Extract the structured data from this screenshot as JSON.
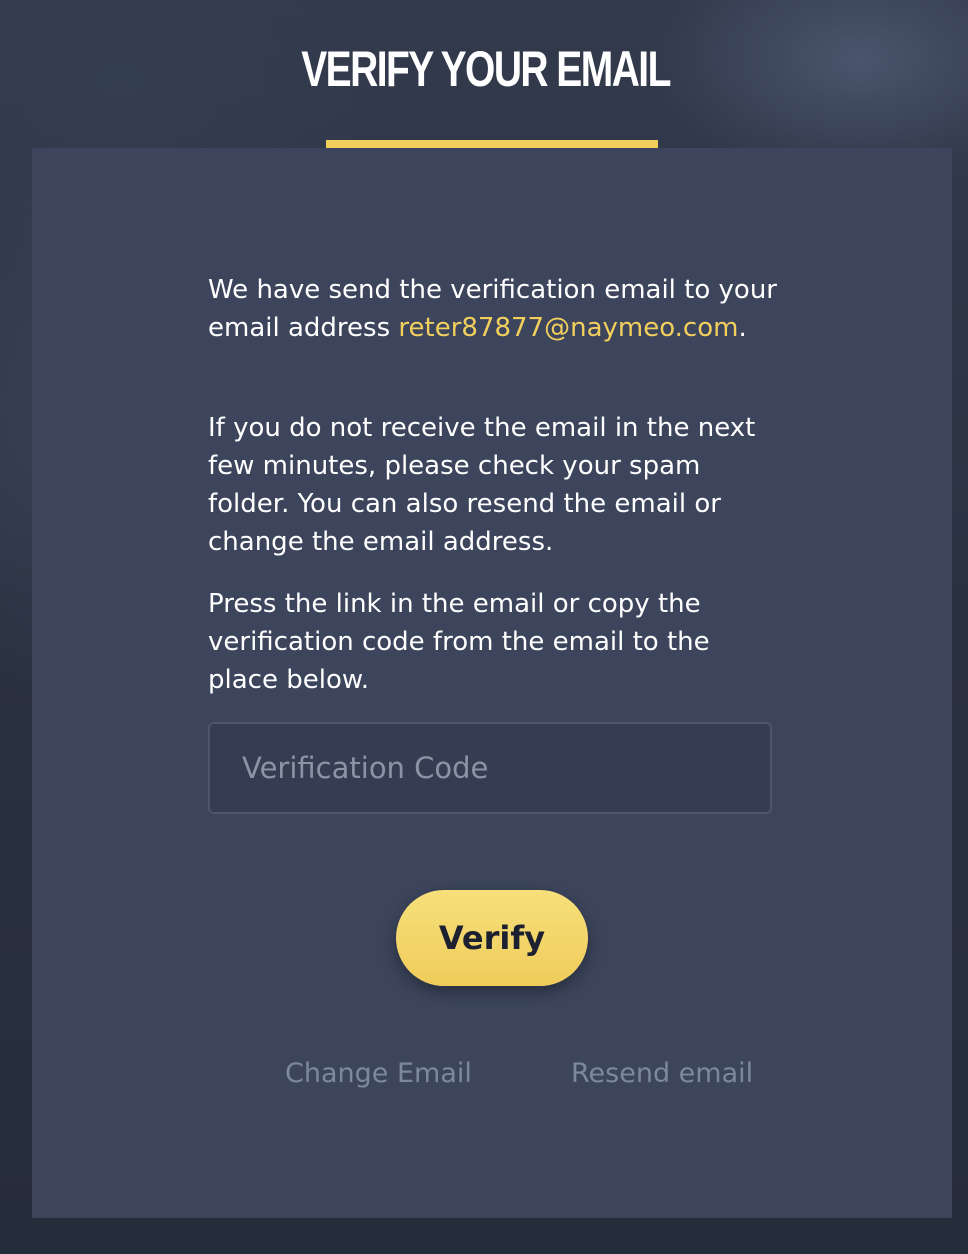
{
  "header": {
    "title": "VERIFY YOUR EMAIL"
  },
  "message": {
    "paragraph1_prefix": "We have send the verification email to your email address ",
    "email": "reter87877@naymeo.com",
    "paragraph1_suffix": ".",
    "paragraph2": "If you do not receive the email in the next few minutes, please check your spam folder. You can also resend the email or change the email address.",
    "paragraph3": "Press the link in the email or copy the verification code from the email to the place below."
  },
  "form": {
    "code_placeholder": "Verification Code",
    "code_value": "",
    "verify_label": "Verify"
  },
  "links": {
    "change_email": "Change Email",
    "resend_email": "Resend email"
  },
  "colors": {
    "accent": "#f2cf5d",
    "panel": "#3c455c",
    "link": "#7e889c"
  }
}
